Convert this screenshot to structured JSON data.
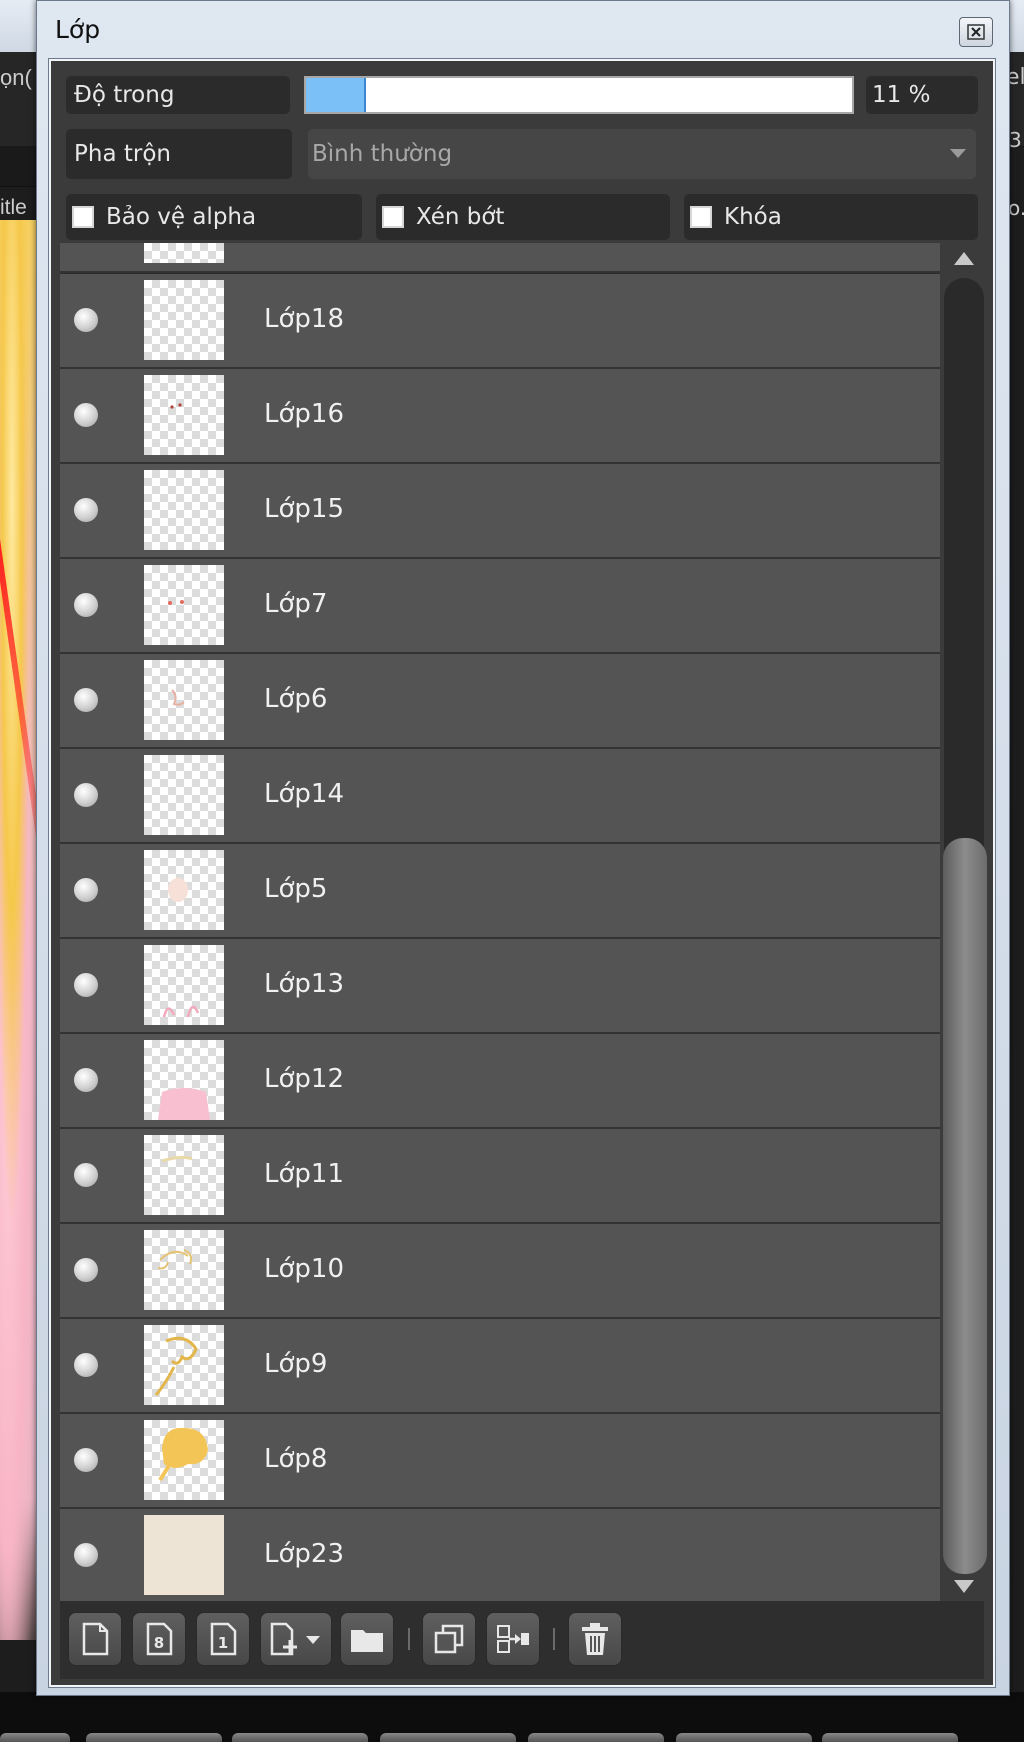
{
  "window": {
    "title": "Lớp"
  },
  "background": {
    "left_text_1": "ọn(",
    "left_text_2": "itle",
    "right_text_1": "el",
    "right_text_2": "3",
    "right_text_3": "o."
  },
  "opacity": {
    "label": "Độ trong",
    "value": 11,
    "value_text": "11 %"
  },
  "blend": {
    "label": "Pha trộn",
    "selected": "Bình thường"
  },
  "checkboxes": [
    {
      "label": "Bảo vệ alpha",
      "checked": false
    },
    {
      "label": "Xén bớt",
      "checked": false
    },
    {
      "label": "Khóa",
      "checked": false
    }
  ],
  "layers": [
    {
      "name": "Lớp18",
      "visible": true,
      "thumb": "empty"
    },
    {
      "name": "Lớp16",
      "visible": true,
      "thumb": "dots-red"
    },
    {
      "name": "Lớp15",
      "visible": true,
      "thumb": "empty"
    },
    {
      "name": "Lớp7",
      "visible": true,
      "thumb": "dots-red"
    },
    {
      "name": "Lớp6",
      "visible": true,
      "thumb": "sketch-pink"
    },
    {
      "name": "Lớp14",
      "visible": true,
      "thumb": "empty"
    },
    {
      "name": "Lớp5",
      "visible": true,
      "thumb": "skin"
    },
    {
      "name": "Lớp13",
      "visible": true,
      "thumb": "pink-lines"
    },
    {
      "name": "Lớp12",
      "visible": true,
      "thumb": "pink-shape"
    },
    {
      "name": "Lớp11",
      "visible": true,
      "thumb": "yellow-line"
    },
    {
      "name": "Lớp10",
      "visible": true,
      "thumb": "yellow-sketch"
    },
    {
      "name": "Lớp9",
      "visible": true,
      "thumb": "yellow-hair"
    },
    {
      "name": "Lớp8",
      "visible": true,
      "thumb": "yellow-fill"
    },
    {
      "name": "Lớp23",
      "visible": true,
      "thumb": "beige-solid"
    }
  ],
  "toolbar": {
    "buttons": [
      "new-layer-icon",
      "new-8bit-layer-icon",
      "new-1bit-layer-icon",
      "add-layer-menu-icon",
      "new-folder-icon",
      "duplicate-layer-icon",
      "merge-down-icon",
      "delete-layer-icon"
    ]
  },
  "colors": {
    "accent": "#7cc0f8",
    "panel": "#3b3b3b",
    "row": "#545454"
  }
}
